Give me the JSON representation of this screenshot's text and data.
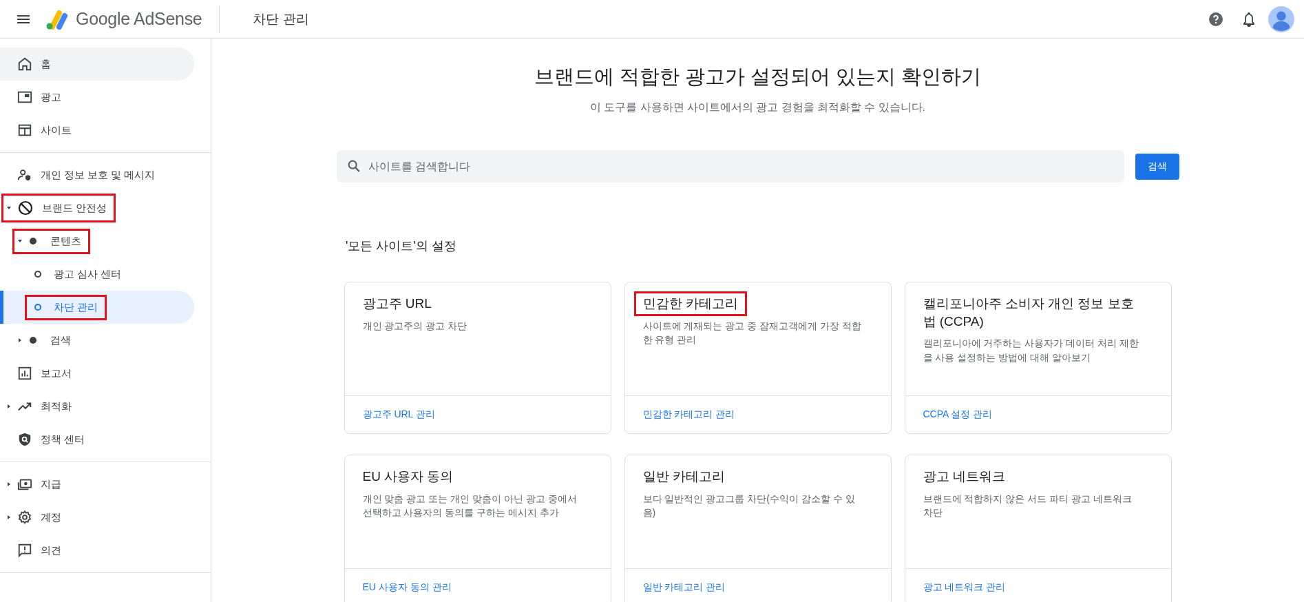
{
  "header": {
    "product": "Google AdSense",
    "page_title": "차단 관리"
  },
  "sidebar": {
    "sections": [
      [
        {
          "label": "홈",
          "selected": false,
          "hovered": true,
          "highlighted": false
        },
        {
          "label": "광고",
          "selected": false,
          "hovered": false,
          "highlighted": false
        },
        {
          "label": "사이트",
          "selected": false,
          "hovered": false,
          "highlighted": false
        }
      ],
      [
        {
          "label": "개인 정보 보호 및 메시지",
          "selected": false,
          "hovered": false,
          "highlighted": false
        },
        {
          "label": "브랜드 안전성",
          "selected": false,
          "hovered": false,
          "highlighted": true,
          "expanded": true,
          "children": [
            {
              "label": "콘텐츠",
              "selected": false,
              "hovered": false,
              "highlighted": true,
              "expanded": true,
              "children": [
                {
                  "label": "광고 심사 센터",
                  "selected": false,
                  "hovered": false,
                  "highlighted": false
                },
                {
                  "label": "차단 관리",
                  "selected": true,
                  "hovered": false,
                  "highlighted": true
                }
              ]
            },
            {
              "label": "검색",
              "selected": false,
              "hovered": false,
              "highlighted": false,
              "expanded": false
            }
          ]
        },
        {
          "label": "보고서",
          "selected": false,
          "hovered": false,
          "highlighted": false
        },
        {
          "label": "최적화",
          "selected": false,
          "hovered": false,
          "highlighted": false,
          "expanded": false
        },
        {
          "label": "정책 센터",
          "selected": false,
          "hovered": false,
          "highlighted": false
        }
      ],
      [
        {
          "label": "지급",
          "selected": false,
          "hovered": false,
          "highlighted": false,
          "expanded": false
        },
        {
          "label": "계정",
          "selected": false,
          "hovered": false,
          "highlighted": false,
          "expanded": false
        },
        {
          "label": "의견",
          "selected": false,
          "hovered": false,
          "highlighted": false
        }
      ]
    ]
  },
  "main": {
    "title": "브랜드에 적합한 광고가 설정되어 있는지 확인하기",
    "subtitle": "이 도구를 사용하면 사이트에서의 광고 경험을 최적화할 수 있습니다.",
    "search": {
      "placeholder": "사이트를 검색합니다",
      "button": "검색"
    },
    "section_title": "'모든 사이트'의 설정",
    "cards": [
      {
        "title": "광고주 URL",
        "description": "개인 광고주의 광고 차단",
        "link": "광고주 URL 관리",
        "highlighted": false
      },
      {
        "title": "민감한 카테고리",
        "description": "사이트에 게재되는 광고 중 잠재고객에게 가장 적합한 유형 관리",
        "link": "민감한 카테고리 관리",
        "highlighted": true
      },
      {
        "title": "캘리포니아주 소비자 개인 정보 보호법 (CCPA)",
        "description": "캘리포니아에 거주하는 사용자가 데이터 처리 제한을 사용 설정하는 방법에 대해 알아보기",
        "link": "CCPA 설정 관리",
        "highlighted": false
      },
      {
        "title": "EU 사용자 동의",
        "description": "개인 맞춤 광고 또는 개인 맞춤이 아닌 광고 중에서 선택하고 사용자의 동의를 구하는 메시지 추가",
        "link": "EU 사용자 동의 관리",
        "highlighted": false
      },
      {
        "title": "일반 카테고리",
        "description": "보다 일반적인 광고그룹 차단(수익이 감소할 수 있음)",
        "link": "일반 카테고리 관리",
        "highlighted": false
      },
      {
        "title": "광고 네트워크",
        "description": "브랜드에 적합하지 않은 서드 파티 광고 네트워크 차단",
        "link": "광고 네트워크 관리",
        "highlighted": false
      }
    ]
  }
}
